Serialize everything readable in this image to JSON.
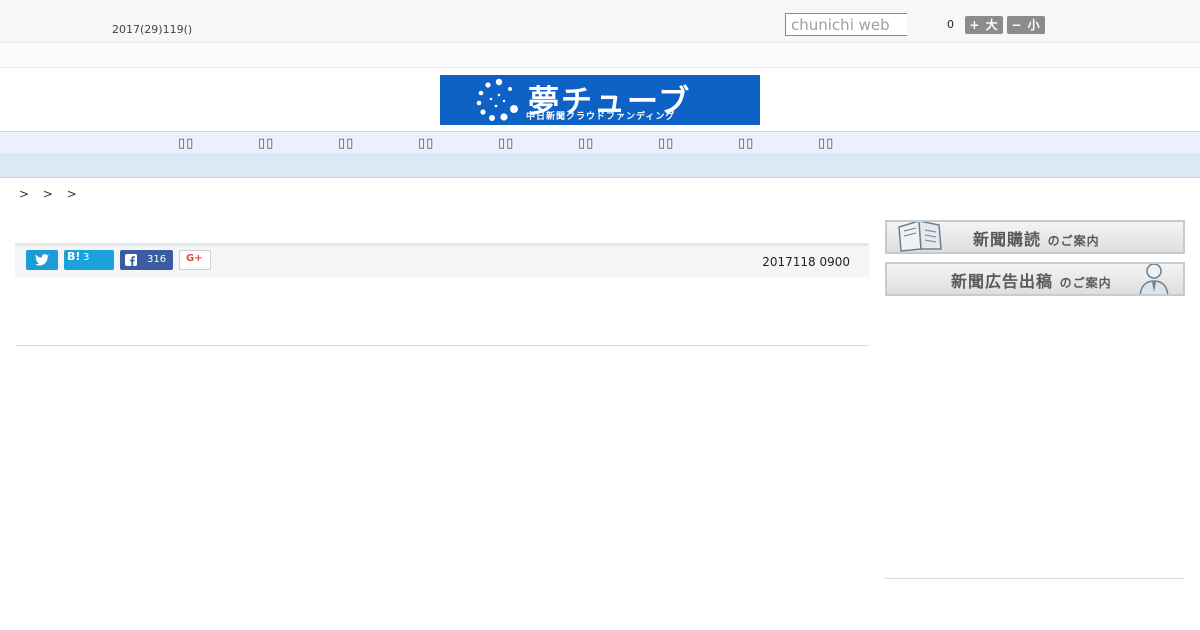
{
  "topbar": {
    "date": "2017(29)119()",
    "search_placeholder": "chunichi web",
    "count": "0",
    "font_larger": "+ 大",
    "font_smaller": "− 小"
  },
  "logo": {
    "title": "夢チューブ",
    "subtitle": "中日新聞クラウドファンディング",
    "bg_color": "#0e62c6"
  },
  "nav": {
    "items": [
      "▯▯",
      "▯▯",
      "▯▯",
      "▯▯",
      "▯▯",
      "▯▯",
      "▯▯",
      "▯▯",
      "▯▯"
    ]
  },
  "breadcrumb": "> > >",
  "share": {
    "twitter_icon": "twitter-icon",
    "hatena_label": "B!",
    "hatena_count": "3",
    "facebook_count": "316",
    "gplus_label": "G+"
  },
  "article": {
    "published": "2017118 0900"
  },
  "sidebar": {
    "subscribe_main": "新聞購読",
    "subscribe_small": "のご案内",
    "ad_main": "新聞広告出稿",
    "ad_small": "のご案内"
  },
  "colors": {
    "nav_bg": "#eaf1fa",
    "twitter": "#1d9bd8",
    "hatena": "#1ba1dc",
    "facebook": "#3b5ca0",
    "gplus": "#dd4b39"
  }
}
